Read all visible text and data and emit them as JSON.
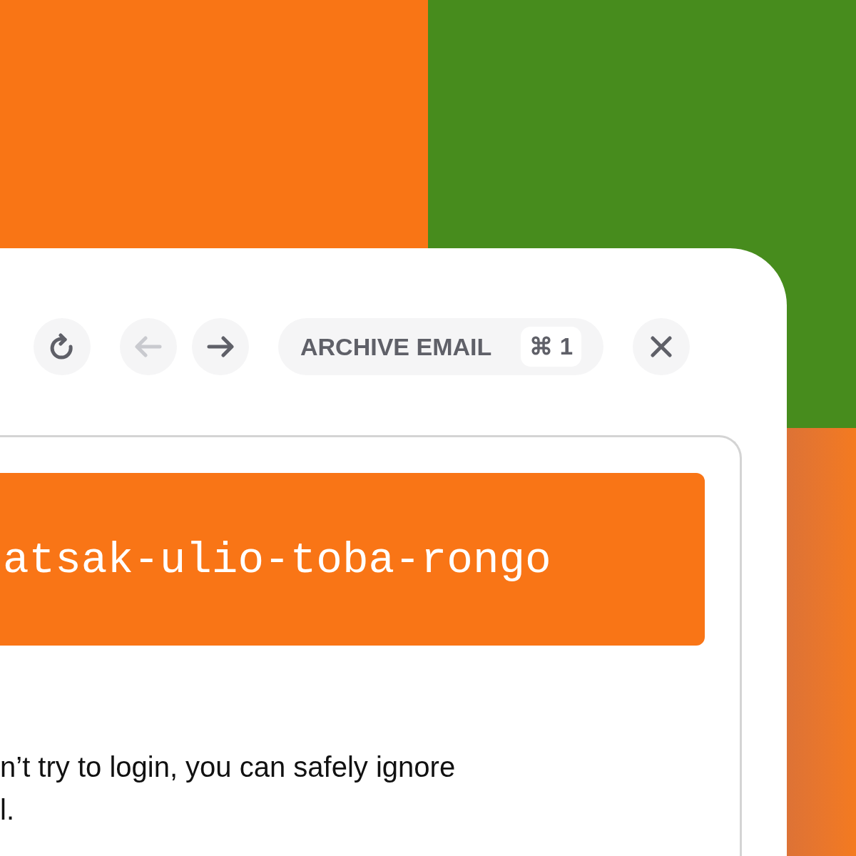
{
  "toolbar": {
    "buttons": [
      {
        "kind": "refresh",
        "disabled": false
      },
      {
        "kind": "back",
        "disabled": true
      },
      {
        "kind": "forward",
        "disabled": false
      }
    ],
    "action": {
      "label": "ARCHIVE EMAIL",
      "shortcut": "⌘ 1"
    },
    "close": {
      "kind": "close",
      "disabled": false
    }
  },
  "email": {
    "code": "atsak-ulio-toba-rongo",
    "lines": [
      "n’t try to login, you can safely ignore",
      "l."
    ]
  }
}
